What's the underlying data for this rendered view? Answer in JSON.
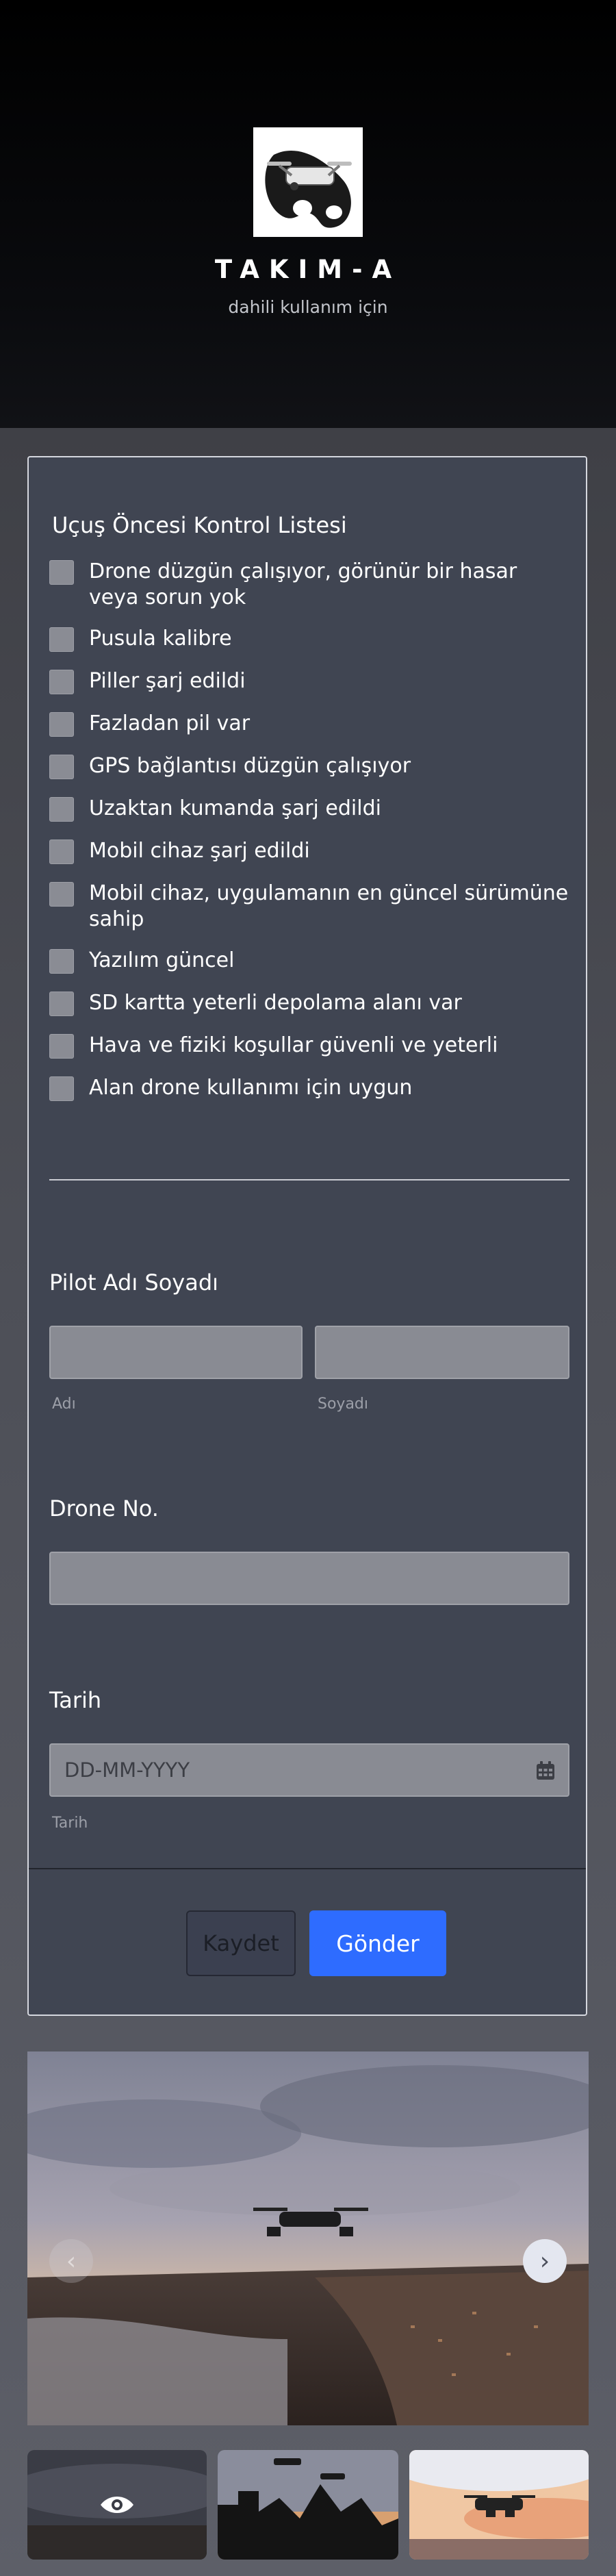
{
  "brand": {
    "name": "TAKIM-A",
    "subtitle": "dahili kullanım için",
    "logo_icon": "drone-logo-icon"
  },
  "checklist": {
    "title": "Uçuş Öncesi Kontrol Listesi",
    "items": [
      {
        "label": "Drone düzgün çalışıyor, görünür bir hasar veya sorun yok",
        "checked": false
      },
      {
        "label": "Pusula kalibre",
        "checked": false
      },
      {
        "label": "Piller şarj edildi",
        "checked": false
      },
      {
        "label": "Fazladan pil var",
        "checked": false
      },
      {
        "label": "GPS bağlantısı düzgün çalışıyor",
        "checked": false
      },
      {
        "label": "Uzaktan kumanda şarj edildi",
        "checked": false
      },
      {
        "label": "Mobil cihaz şarj edildi",
        "checked": false
      },
      {
        "label": "Mobil cihaz, uygulamanın en güncel sürümüne sahip",
        "checked": false
      },
      {
        "label": "Yazılım güncel",
        "checked": false
      },
      {
        "label": "SD kartta yeterli depolama alanı var",
        "checked": false
      },
      {
        "label": "Hava ve fiziki koşullar güvenli ve yeterli",
        "checked": false
      },
      {
        "label": "Alan drone kullanımı için uygun",
        "checked": false
      }
    ]
  },
  "pilot": {
    "label": "Pilot Adı Soyadı",
    "first_sublabel": "Adı",
    "last_sublabel": "Soyadı",
    "first_value": "",
    "last_value": ""
  },
  "drone": {
    "label": "Drone No.",
    "value": ""
  },
  "date": {
    "label": "Tarih",
    "placeholder": "DD-MM-YYYY",
    "sublabel": "Tarih",
    "icon": "calendar-icon"
  },
  "buttons": {
    "save": "Kaydet",
    "submit": "Gönder"
  },
  "gallery": {
    "prev_icon": "chevron-left-icon",
    "next_icon": "chevron-right-icon",
    "thumb_icon": "eye-icon",
    "colors": {
      "accent": "#2e6cff",
      "card": "#404552"
    }
  }
}
